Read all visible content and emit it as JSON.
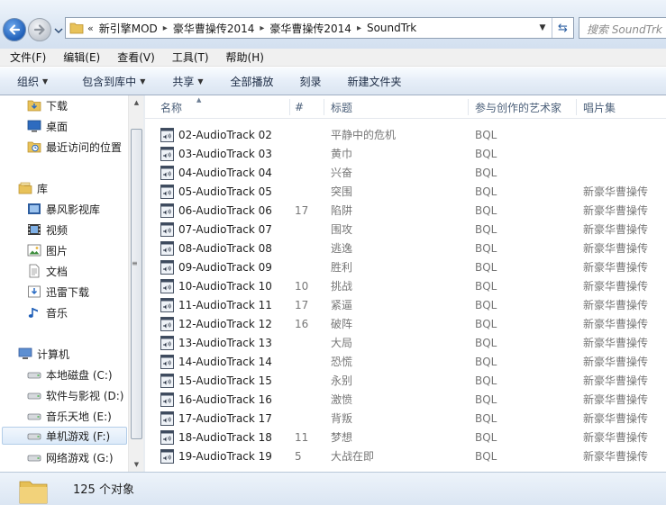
{
  "address": {
    "lead": "«",
    "crumbs": [
      "新引擎MOD",
      "豪华曹操传2014",
      "豪华曹操传2014",
      "SoundTrk"
    ],
    "search_placeholder": "搜索 SoundTrk"
  },
  "menu": [
    "文件(F)",
    "编辑(E)",
    "查看(V)",
    "工具(T)",
    "帮助(H)"
  ],
  "toolbar": {
    "organize": "组织",
    "include": "包含到库中",
    "share": "共享",
    "play_all": "全部播放",
    "burn": "刻录",
    "new_folder": "新建文件夹"
  },
  "nav": {
    "downloads": "下载",
    "desktop": "桌面",
    "recent": "最近访问的位置",
    "libraries": "库",
    "storm": "暴风影视库",
    "videos": "视频",
    "pictures": "图片",
    "documents": "文档",
    "thunder": "迅雷下载",
    "music": "音乐",
    "computer": "计算机",
    "drive_c": "本地磁盘 (C:)",
    "drive_d": "软件与影视 (D:)",
    "drive_e": "音乐天地 (E:)",
    "drive_f": "单机游戏 (F:)",
    "drive_g": "网络游戏 (G:)"
  },
  "columns": {
    "name": "名称",
    "number": "#",
    "title": "标题",
    "artist": "参与创作的艺术家",
    "album": "唱片集"
  },
  "files": [
    {
      "name": "02-AudioTrack 02",
      "number": "",
      "title": "平静中的危机",
      "artist": "BQL",
      "album": ""
    },
    {
      "name": "03-AudioTrack 03",
      "number": "",
      "title": "黄巾",
      "artist": "BQL",
      "album": ""
    },
    {
      "name": "04-AudioTrack 04",
      "number": "",
      "title": "兴奋",
      "artist": "BQL",
      "album": ""
    },
    {
      "name": "05-AudioTrack 05",
      "number": "",
      "title": "突围",
      "artist": "BQL",
      "album": "新豪华曹操传"
    },
    {
      "name": "06-AudioTrack 06",
      "number": "17",
      "title": "陷阱",
      "artist": "BQL",
      "album": "新豪华曹操传"
    },
    {
      "name": "07-AudioTrack 07",
      "number": "",
      "title": "围攻",
      "artist": "BQL",
      "album": "新豪华曹操传"
    },
    {
      "name": "08-AudioTrack 08",
      "number": "",
      "title": "逃逸",
      "artist": "BQL",
      "album": "新豪华曹操传"
    },
    {
      "name": "09-AudioTrack 09",
      "number": "",
      "title": "胜利",
      "artist": "BQL",
      "album": "新豪华曹操传"
    },
    {
      "name": "10-AudioTrack 10",
      "number": "10",
      "title": "挑战",
      "artist": "BQL",
      "album": "新豪华曹操传"
    },
    {
      "name": "11-AudioTrack 11",
      "number": "17",
      "title": "紧逼",
      "artist": "BQL",
      "album": "新豪华曹操传"
    },
    {
      "name": "12-AudioTrack 12",
      "number": "16",
      "title": "破阵",
      "artist": "BQL",
      "album": "新豪华曹操传"
    },
    {
      "name": "13-AudioTrack 13",
      "number": "",
      "title": "大局",
      "artist": "BQL",
      "album": "新豪华曹操传"
    },
    {
      "name": "14-AudioTrack 14",
      "number": "",
      "title": "恐慌",
      "artist": "BQL",
      "album": "新豪华曹操传"
    },
    {
      "name": "15-AudioTrack 15",
      "number": "",
      "title": "永别",
      "artist": "BQL",
      "album": "新豪华曹操传"
    },
    {
      "name": "16-AudioTrack 16",
      "number": "",
      "title": "激愤",
      "artist": "BQL",
      "album": "新豪华曹操传"
    },
    {
      "name": "17-AudioTrack 17",
      "number": "",
      "title": "背叛",
      "artist": "BQL",
      "album": "新豪华曹操传"
    },
    {
      "name": "18-AudioTrack 18",
      "number": "11",
      "title": "梦想",
      "artist": "BQL",
      "album": "新豪华曹操传"
    },
    {
      "name": "19-AudioTrack 19",
      "number": "5",
      "title": "大战在即",
      "artist": "BQL",
      "album": "新豪华曹操传"
    }
  ],
  "status": {
    "count": "125 个对象"
  }
}
